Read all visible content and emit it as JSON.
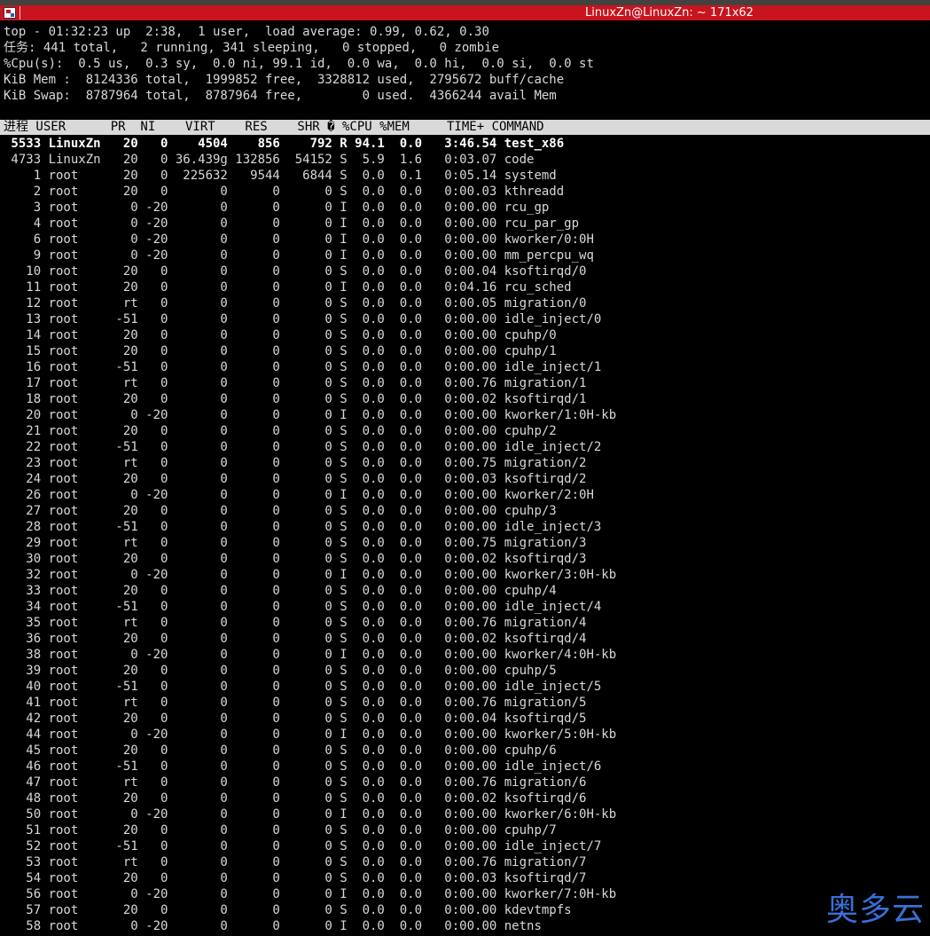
{
  "window": {
    "title": "LinuxZn@LinuxZn: ~ 171x62"
  },
  "summary": [
    "top - 01:32:23 up  2:38,  1 user,  load average: 0.99, 0.62, 0.30",
    "任务: 441 total,   2 running, 341 sleeping,   0 stopped,   0 zombie",
    "%Cpu(s):  0.5 us,  0.3 sy,  0.0 ni, 99.1 id,  0.0 wa,  0.0 hi,  0.0 si,  0.0 st",
    "KiB Mem :  8124336 total,  1999852 free,  3328812 used,  2795672 buff/cache",
    "KiB Swap:  8787964 total,  8787964 free,        0 used.  4366244 avail Mem"
  ],
  "table": {
    "header": "进程 USER      PR  NI    VIRT    RES    SHR � %CPU %MEM     TIME+ COMMAND",
    "rows": [
      {
        "text": " 5533 LinuxZn   20   0    4504    856    792 R 94.1  0.0   3:46.54 test_x86",
        "state": "running"
      },
      {
        "text": " 4733 LinuxZn   20   0 36.439g 132856  54152 S  5.9  1.6   0:03.07 code",
        "state": "normal"
      },
      {
        "text": "    1 root      20   0  225632   9544   6844 S  0.0  0.1   0:05.14 systemd",
        "state": "normal"
      },
      {
        "text": "    2 root      20   0       0      0      0 S  0.0  0.0   0:00.03 kthreadd",
        "state": "normal"
      },
      {
        "text": "    3 root       0 -20       0      0      0 I  0.0  0.0   0:00.00 rcu_gp",
        "state": "normal"
      },
      {
        "text": "    4 root       0 -20       0      0      0 I  0.0  0.0   0:00.00 rcu_par_gp",
        "state": "normal"
      },
      {
        "text": "    6 root       0 -20       0      0      0 I  0.0  0.0   0:00.00 kworker/0:0H",
        "state": "normal"
      },
      {
        "text": "    9 root       0 -20       0      0      0 I  0.0  0.0   0:00.00 mm_percpu_wq",
        "state": "normal"
      },
      {
        "text": "   10 root      20   0       0      0      0 S  0.0  0.0   0:00.04 ksoftirqd/0",
        "state": "normal"
      },
      {
        "text": "   11 root      20   0       0      0      0 I  0.0  0.0   0:04.16 rcu_sched",
        "state": "normal"
      },
      {
        "text": "   12 root      rt   0       0      0      0 S  0.0  0.0   0:00.05 migration/0",
        "state": "normal"
      },
      {
        "text": "   13 root     -51   0       0      0      0 S  0.0  0.0   0:00.00 idle_inject/0",
        "state": "normal"
      },
      {
        "text": "   14 root      20   0       0      0      0 S  0.0  0.0   0:00.00 cpuhp/0",
        "state": "normal"
      },
      {
        "text": "   15 root      20   0       0      0      0 S  0.0  0.0   0:00.00 cpuhp/1",
        "state": "normal"
      },
      {
        "text": "   16 root     -51   0       0      0      0 S  0.0  0.0   0:00.00 idle_inject/1",
        "state": "normal"
      },
      {
        "text": "   17 root      rt   0       0      0      0 S  0.0  0.0   0:00.76 migration/1",
        "state": "normal"
      },
      {
        "text": "   18 root      20   0       0      0      0 S  0.0  0.0   0:00.02 ksoftirqd/1",
        "state": "normal"
      },
      {
        "text": "   20 root       0 -20       0      0      0 I  0.0  0.0   0:00.00 kworker/1:0H-kb",
        "state": "normal"
      },
      {
        "text": "   21 root      20   0       0      0      0 S  0.0  0.0   0:00.00 cpuhp/2",
        "state": "normal"
      },
      {
        "text": "   22 root     -51   0       0      0      0 S  0.0  0.0   0:00.00 idle_inject/2",
        "state": "normal"
      },
      {
        "text": "   23 root      rt   0       0      0      0 S  0.0  0.0   0:00.75 migration/2",
        "state": "normal"
      },
      {
        "text": "   24 root      20   0       0      0      0 S  0.0  0.0   0:00.03 ksoftirqd/2",
        "state": "normal"
      },
      {
        "text": "   26 root       0 -20       0      0      0 I  0.0  0.0   0:00.00 kworker/2:0H",
        "state": "normal"
      },
      {
        "text": "   27 root      20   0       0      0      0 S  0.0  0.0   0:00.00 cpuhp/3",
        "state": "normal"
      },
      {
        "text": "   28 root     -51   0       0      0      0 S  0.0  0.0   0:00.00 idle_inject/3",
        "state": "normal"
      },
      {
        "text": "   29 root      rt   0       0      0      0 S  0.0  0.0   0:00.75 migration/3",
        "state": "normal"
      },
      {
        "text": "   30 root      20   0       0      0      0 S  0.0  0.0   0:00.02 ksoftirqd/3",
        "state": "normal"
      },
      {
        "text": "   32 root       0 -20       0      0      0 I  0.0  0.0   0:00.00 kworker/3:0H-kb",
        "state": "normal"
      },
      {
        "text": "   33 root      20   0       0      0      0 S  0.0  0.0   0:00.00 cpuhp/4",
        "state": "normal"
      },
      {
        "text": "   34 root     -51   0       0      0      0 S  0.0  0.0   0:00.00 idle_inject/4",
        "state": "normal"
      },
      {
        "text": "   35 root      rt   0       0      0      0 S  0.0  0.0   0:00.76 migration/4",
        "state": "normal"
      },
      {
        "text": "   36 root      20   0       0      0      0 S  0.0  0.0   0:00.02 ksoftirqd/4",
        "state": "normal"
      },
      {
        "text": "   38 root       0 -20       0      0      0 I  0.0  0.0   0:00.00 kworker/4:0H-kb",
        "state": "normal"
      },
      {
        "text": "   39 root      20   0       0      0      0 S  0.0  0.0   0:00.00 cpuhp/5",
        "state": "normal"
      },
      {
        "text": "   40 root     -51   0       0      0      0 S  0.0  0.0   0:00.00 idle_inject/5",
        "state": "normal"
      },
      {
        "text": "   41 root      rt   0       0      0      0 S  0.0  0.0   0:00.76 migration/5",
        "state": "normal"
      },
      {
        "text": "   42 root      20   0       0      0      0 S  0.0  0.0   0:00.04 ksoftirqd/5",
        "state": "normal"
      },
      {
        "text": "   44 root       0 -20       0      0      0 I  0.0  0.0   0:00.00 kworker/5:0H-kb",
        "state": "normal"
      },
      {
        "text": "   45 root      20   0       0      0      0 S  0.0  0.0   0:00.00 cpuhp/6",
        "state": "normal"
      },
      {
        "text": "   46 root     -51   0       0      0      0 S  0.0  0.0   0:00.00 idle_inject/6",
        "state": "normal"
      },
      {
        "text": "   47 root      rt   0       0      0      0 S  0.0  0.0   0:00.76 migration/6",
        "state": "normal"
      },
      {
        "text": "   48 root      20   0       0      0      0 S  0.0  0.0   0:00.02 ksoftirqd/6",
        "state": "normal"
      },
      {
        "text": "   50 root       0 -20       0      0      0 I  0.0  0.0   0:00.00 kworker/6:0H-kb",
        "state": "normal"
      },
      {
        "text": "   51 root      20   0       0      0      0 S  0.0  0.0   0:00.00 cpuhp/7",
        "state": "normal"
      },
      {
        "text": "   52 root     -51   0       0      0      0 S  0.0  0.0   0:00.00 idle_inject/7",
        "state": "normal"
      },
      {
        "text": "   53 root      rt   0       0      0      0 S  0.0  0.0   0:00.76 migration/7",
        "state": "normal"
      },
      {
        "text": "   54 root      20   0       0      0      0 S  0.0  0.0   0:00.03 ksoftirqd/7",
        "state": "normal"
      },
      {
        "text": "   56 root       0 -20       0      0      0 I  0.0  0.0   0:00.00 kworker/7:0H-kb",
        "state": "normal"
      },
      {
        "text": "   57 root      20   0       0      0      0 S  0.0  0.0   0:00.00 kdevtmpfs",
        "state": "normal"
      },
      {
        "text": "   58 root       0 -20       0      0      0 I  0.0  0.0   0:00.00 netns",
        "state": "normal"
      }
    ]
  },
  "watermark": "奥多云",
  "colors": {
    "titlebar_red": "#c8141e",
    "terminal_bg": "#000000",
    "header_bg": "#d9d9d9",
    "watermark_blue": "#3a6fd8"
  },
  "icons": {
    "window_icon": "terminal-icon"
  }
}
